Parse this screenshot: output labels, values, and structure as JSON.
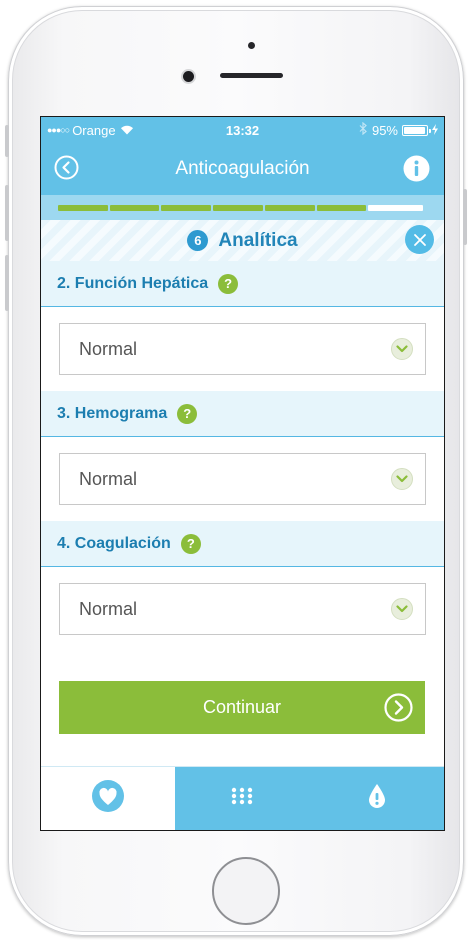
{
  "status_bar": {
    "signal_dots": "●●●○○",
    "carrier": "Orange",
    "time": "13:32",
    "battery": "95%",
    "battery_level": 0.95
  },
  "nav": {
    "title": "Anticoagulación",
    "back_icon": "back-circle-icon",
    "info_icon": "info-icon"
  },
  "progress": {
    "completed_steps": 6,
    "total_steps": 7
  },
  "section": {
    "number": "6",
    "title": "Analítica",
    "close_icon": "close-icon"
  },
  "fields": [
    {
      "label": "2. Función Hepática",
      "help": "?",
      "value": "Normal"
    },
    {
      "label": "3. Hemograma",
      "help": "?",
      "value": "Normal"
    },
    {
      "label": "4. Coagulación",
      "help": "?",
      "value": "Normal"
    }
  ],
  "continue_button": {
    "label": "Continuar",
    "icon": "chevron-right-circle-icon"
  },
  "tab_bar": {
    "tabs": [
      {
        "icon": "heart-drop-icon",
        "active": true
      },
      {
        "icon": "dots-grid-icon",
        "active": false
      },
      {
        "icon": "alert-drop-icon",
        "active": false
      }
    ]
  },
  "colors": {
    "primary_blue": "#62c1e7",
    "accent_green": "#8bbd3a",
    "label_blue": "#1c7eb0"
  }
}
